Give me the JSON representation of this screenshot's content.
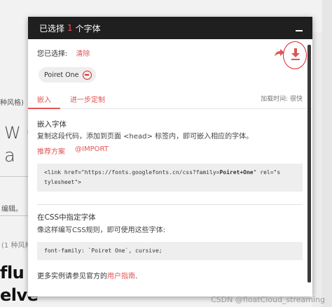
{
  "background": {
    "styles_fragment": "种风格)",
    "specimen_line1": "WO",
    "specimen_line2": "a c",
    "edit_fragment": "编辑。",
    "styles_fragment_2": "(1 种风格",
    "specimen_line3": "flu",
    "specimen_line4": "elve"
  },
  "modal": {
    "header": {
      "prefix": "已选择",
      "count": "1",
      "suffix": "个字体"
    },
    "selected": {
      "label": "您已选择:",
      "clear": "清除"
    },
    "chip": {
      "font_name": "Poiret One"
    },
    "tabs": [
      {
        "label": "嵌入"
      },
      {
        "label": "进一步定制"
      }
    ],
    "load_time": "加载时间: 很快",
    "embed": {
      "title": "嵌入字体",
      "desc": "复制这段代码，添加到页面 <head> 标签内，即可嵌入相应的字体。",
      "link_recommended": "推荐方案",
      "link_import": "@IMPORT",
      "code_prefix": "<link href=\"https://fonts.googlefonts.cn/css?family=",
      "code_family": "Poiret+One",
      "code_suffix1": "\" rel=\"s",
      "code_line2": "tylesheet\">"
    },
    "css": {
      "title": "在CSS中指定字体",
      "desc": "像这样编写CSS规则，即可使用这些字体:",
      "code": "font-family: `Poiret One`, cursive;"
    },
    "guide": {
      "prefix": "更多实例请参见官方的",
      "link": "用户指南",
      "suffix": "."
    }
  },
  "watermark": "CSDN @floatCloud_streaming",
  "colors": {
    "accent": "#e05555",
    "highlight_circle": "#e0242a",
    "header_bg": "#1f1f1f"
  }
}
